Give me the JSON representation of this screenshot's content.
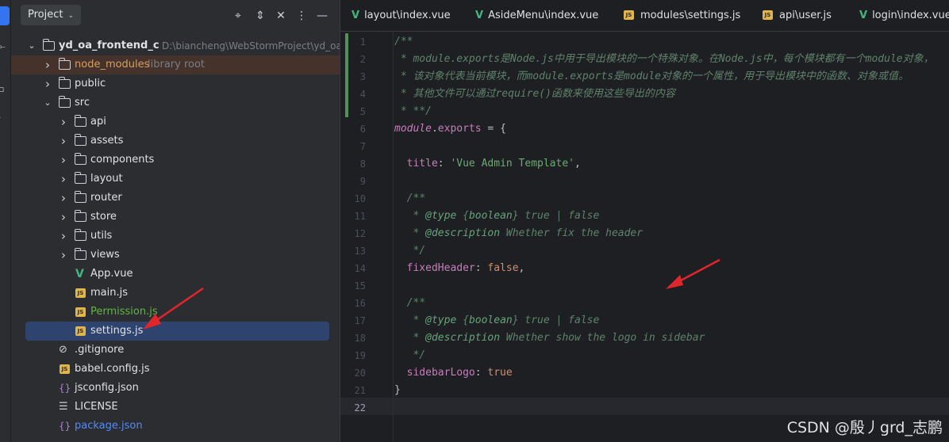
{
  "sidebar_strip": {
    "items": [
      "project-tool",
      "commit-tool",
      "structure-tool",
      "more-tool"
    ]
  },
  "project_panel": {
    "title": "Project",
    "caret": "⌄",
    "header_icons": [
      "locate-icon",
      "expand-collapse-icon",
      "collapse-all-icon",
      "more-options-icon",
      "hide-icon"
    ]
  },
  "tree": [
    {
      "label": "yd_oa_frontend_c",
      "suffix": "D:\\biancheng\\WebStormProject\\yd_oa_fro",
      "type": "folder",
      "depth": 0,
      "expanded": true,
      "bold": true
    },
    {
      "label": "node_modules",
      "suffix": "library root",
      "type": "folder",
      "depth": 1,
      "expanded": false,
      "color": "orange",
      "highlight": true
    },
    {
      "label": "public",
      "type": "folder",
      "depth": 1,
      "expanded": false
    },
    {
      "label": "src",
      "type": "folder",
      "depth": 1,
      "expanded": true
    },
    {
      "label": "api",
      "type": "folder",
      "depth": 2,
      "expanded": false
    },
    {
      "label": "assets",
      "type": "folder",
      "depth": 2,
      "expanded": false
    },
    {
      "label": "components",
      "type": "folder",
      "depth": 2,
      "expanded": false
    },
    {
      "label": "layout",
      "type": "folder",
      "depth": 2,
      "expanded": false
    },
    {
      "label": "router",
      "type": "folder",
      "depth": 2,
      "expanded": false
    },
    {
      "label": "store",
      "type": "folder",
      "depth": 2,
      "expanded": false
    },
    {
      "label": "utils",
      "type": "folder",
      "depth": 2,
      "expanded": false
    },
    {
      "label": "views",
      "type": "folder",
      "depth": 2,
      "expanded": false
    },
    {
      "label": "App.vue",
      "type": "vue",
      "depth": 2
    },
    {
      "label": "main.js",
      "type": "js",
      "depth": 2
    },
    {
      "label": "Permission.js",
      "type": "js",
      "depth": 2,
      "color": "green"
    },
    {
      "label": "settings.js",
      "type": "js",
      "depth": 2,
      "selected": true
    },
    {
      "label": ".gitignore",
      "type": "ignore",
      "depth": 1
    },
    {
      "label": "babel.config.js",
      "type": "js",
      "depth": 1
    },
    {
      "label": "jsconfig.json",
      "type": "json",
      "depth": 1
    },
    {
      "label": "LICENSE",
      "type": "text",
      "depth": 1
    },
    {
      "label": "package.json",
      "type": "json",
      "depth": 1,
      "color": "blue"
    }
  ],
  "editor": {
    "tabs": [
      {
        "label": "layout\\index.vue",
        "kind": "vue"
      },
      {
        "label": "AsideMenu\\index.vue",
        "kind": "vue"
      },
      {
        "label": "modules\\settings.js",
        "kind": "js"
      },
      {
        "label": "api\\user.js",
        "kind": "js"
      },
      {
        "label": "login\\index.vue",
        "kind": "vue"
      }
    ],
    "line_numbers": [
      "1",
      "2",
      "3",
      "4",
      "5",
      "6",
      "7",
      "8",
      "9",
      "10",
      "11",
      "12",
      "13",
      "14",
      "15",
      "16",
      "17",
      "18",
      "19",
      "20",
      "21",
      "22"
    ],
    "current_line": 22,
    "lines": [
      [
        {
          "t": "/**",
          "c": "c-doc"
        }
      ],
      [
        {
          "t": " * ",
          "c": "c-doc"
        },
        {
          "t": "module.exports是Node.js中用于导出模块的一个特殊对象。在Node.js中，每个模块都有一个module对象，",
          "c": "c-doc"
        }
      ],
      [
        {
          "t": " * 该对象代表当前模块，而module.exports是module对象的一个属性，用于导出模块中的函数、对象或值。",
          "c": "c-doc"
        }
      ],
      [
        {
          "t": " * 其他文件可以通过require()函数来使用这些导出的内容",
          "c": "c-doc"
        }
      ],
      [
        {
          "t": " * **/",
          "c": "c-doc"
        }
      ],
      [
        {
          "t": "module",
          "c": "c-mod"
        },
        {
          "t": ".",
          "c": ""
        },
        {
          "t": "exports",
          "c": "c-prop"
        },
        {
          "t": " = {",
          "c": ""
        }
      ],
      [
        {
          "t": "",
          "c": ""
        }
      ],
      [
        {
          "t": "  ",
          "c": ""
        },
        {
          "t": "title",
          "c": "c-prop"
        },
        {
          "t": ": ",
          "c": ""
        },
        {
          "t": "'Vue Admin Template'",
          "c": "c-str"
        },
        {
          "t": ",",
          "c": ""
        }
      ],
      [
        {
          "t": "",
          "c": ""
        }
      ],
      [
        {
          "t": "  /**",
          "c": "c-doc"
        }
      ],
      [
        {
          "t": "   * ",
          "c": "c-doc"
        },
        {
          "t": "@type",
          "c": "c-tag"
        },
        {
          "t": " {",
          "c": "c-doc"
        },
        {
          "t": "boolean",
          "c": "c-type"
        },
        {
          "t": "} true | false",
          "c": "c-doc"
        }
      ],
      [
        {
          "t": "   * ",
          "c": "c-doc"
        },
        {
          "t": "@description",
          "c": "c-tag"
        },
        {
          "t": " Whether fix the header",
          "c": "c-doc"
        }
      ],
      [
        {
          "t": "   */",
          "c": "c-doc"
        }
      ],
      [
        {
          "t": "  ",
          "c": ""
        },
        {
          "t": "fixedHeader",
          "c": "c-prop"
        },
        {
          "t": ": ",
          "c": ""
        },
        {
          "t": "false",
          "c": "c-kw"
        },
        {
          "t": ",",
          "c": ""
        }
      ],
      [
        {
          "t": "",
          "c": ""
        }
      ],
      [
        {
          "t": "  /**",
          "c": "c-doc"
        }
      ],
      [
        {
          "t": "   * ",
          "c": "c-doc"
        },
        {
          "t": "@type",
          "c": "c-tag"
        },
        {
          "t": " {",
          "c": "c-doc"
        },
        {
          "t": "boolean",
          "c": "c-type"
        },
        {
          "t": "} true | false",
          "c": "c-doc"
        }
      ],
      [
        {
          "t": "   * ",
          "c": "c-doc"
        },
        {
          "t": "@description",
          "c": "c-tag"
        },
        {
          "t": " Whether show the logo in sidebar",
          "c": "c-doc"
        }
      ],
      [
        {
          "t": "   */",
          "c": "c-doc"
        }
      ],
      [
        {
          "t": "  ",
          "c": ""
        },
        {
          "t": "sidebarLogo",
          "c": "c-prop"
        },
        {
          "t": ": ",
          "c": ""
        },
        {
          "t": "true",
          "c": "c-kw"
        }
      ],
      [
        {
          "t": "}",
          "c": ""
        }
      ],
      [
        {
          "t": "",
          "c": ""
        }
      ]
    ]
  },
  "watermark": "CSDN @殷丿grd_志鹏",
  "colors": {
    "accent": "#3574f0",
    "annotation_arrow": "#e0262b",
    "selection": "#2e436e"
  }
}
